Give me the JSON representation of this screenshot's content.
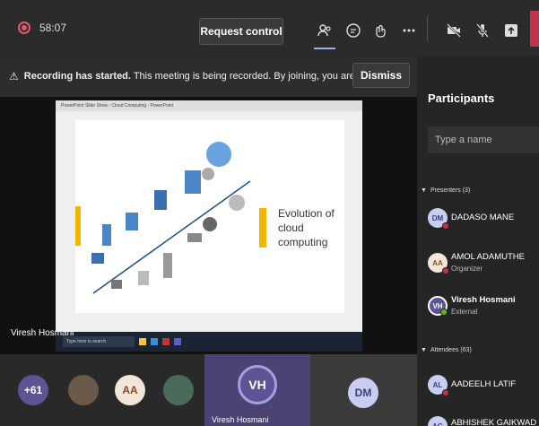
{
  "topbar": {
    "timer": "58:07",
    "request_control_label": "Request control",
    "icons": [
      "participants-icon",
      "chat-icon",
      "reactions-icon",
      "more-icon",
      "camera-off-icon",
      "mic-off-icon",
      "share-icon"
    ]
  },
  "banner": {
    "bold_text": "Recording has started.",
    "text": "This meeting is being recorded. By joining, you are giving co...",
    "dismiss_label": "Dismiss"
  },
  "stage": {
    "window_title": "PowerPoint Slide Show - Cloud Computing - PowerPoint",
    "slide_title_line1": "Evolution of",
    "slide_title_line2": "cloud",
    "slide_title_line3": "computing",
    "presenter_label": "Viresh Hosmani",
    "taskbar_search": "Type here to search"
  },
  "gallery": {
    "overflow_count": "+61",
    "aa_initials": "AA",
    "vh_initials": "VH",
    "vh_name": "Viresh Hosmani",
    "dm_initials": "DM"
  },
  "panel": {
    "title": "Participants",
    "search_placeholder": "Type a name",
    "presenters_label": "Presenters (3)",
    "attendees_label": "Attendees (63)",
    "presenters": [
      {
        "initials": "DM",
        "name": "DADASO MANE",
        "role": ""
      },
      {
        "initials": "AA",
        "name": "AMOL ADAMUTHE",
        "role": "Organizer"
      },
      {
        "initials": "VH",
        "name": "Viresh Hosmani",
        "role": "External"
      }
    ],
    "attendees": [
      {
        "initials": "AL",
        "name": "AADEELH LATIF"
      },
      {
        "initials": "AG",
        "name": "ABHISHEK GAIKWAD"
      }
    ]
  },
  "colors": {
    "accent": "#a3a7ff",
    "danger": "#c4314b",
    "slide_accent": "#f1b600"
  }
}
